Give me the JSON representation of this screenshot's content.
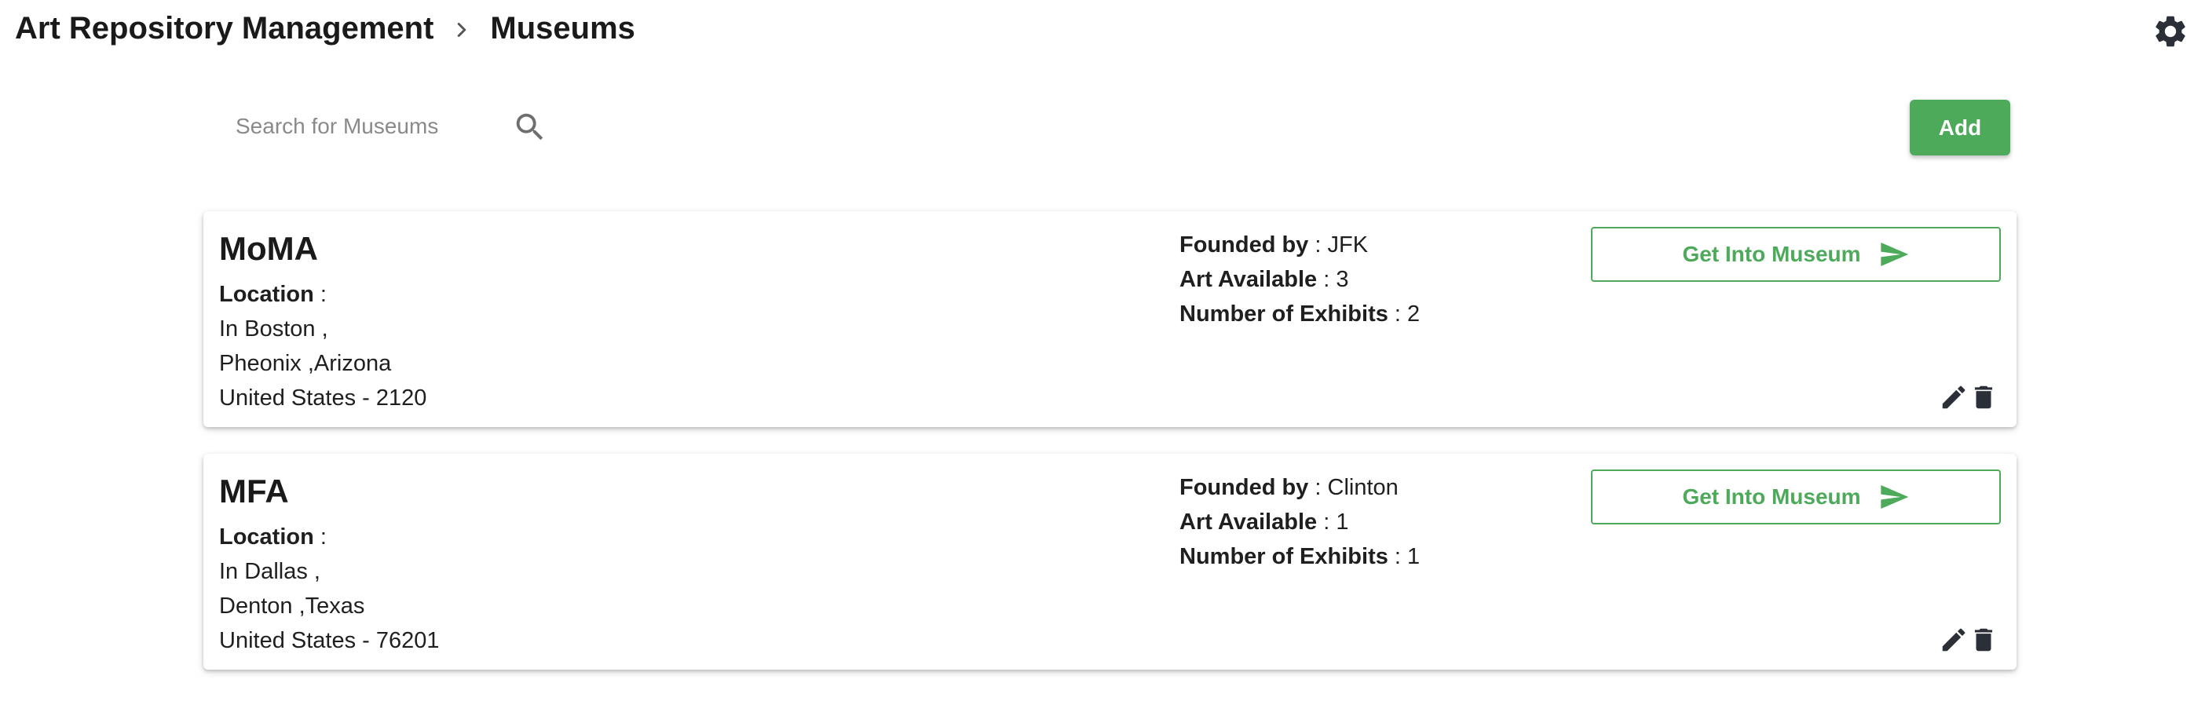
{
  "header": {
    "breadcrumb": [
      "Art Repository Management",
      "Museums"
    ],
    "icons": {
      "separator": "chevron-right-icon",
      "settings": "gear-icon"
    }
  },
  "search": {
    "placeholder": "Search for Museums",
    "value": "",
    "icon": "search-icon"
  },
  "toolbar": {
    "add_label": "Add"
  },
  "colors": {
    "accent": "#4caa5a",
    "text": "#1f1f1f",
    "placeholder": "#8a8a8a"
  },
  "museums": [
    {
      "name": "MoMA",
      "location_label": "Location",
      "location_lines": [
        "In Boston ,",
        "Pheonix ,Arizona",
        "United States - 2120"
      ],
      "founded_by_label": "Founded by",
      "founded_by": "JFK",
      "art_available_label": "Art Available",
      "art_available": "3",
      "exhibits_label": "Number of Exhibits",
      "exhibits": "2",
      "enter_label": "Get Into Museum"
    },
    {
      "name": "MFA",
      "location_label": "Location",
      "location_lines": [
        "In Dallas ,",
        "Denton ,Texas",
        "United States - 76201"
      ],
      "founded_by_label": "Founded by",
      "founded_by": "Clinton",
      "art_available_label": "Art Available",
      "art_available": "1",
      "exhibits_label": "Number of Exhibits",
      "exhibits": "1",
      "enter_label": "Get Into Museum"
    }
  ]
}
